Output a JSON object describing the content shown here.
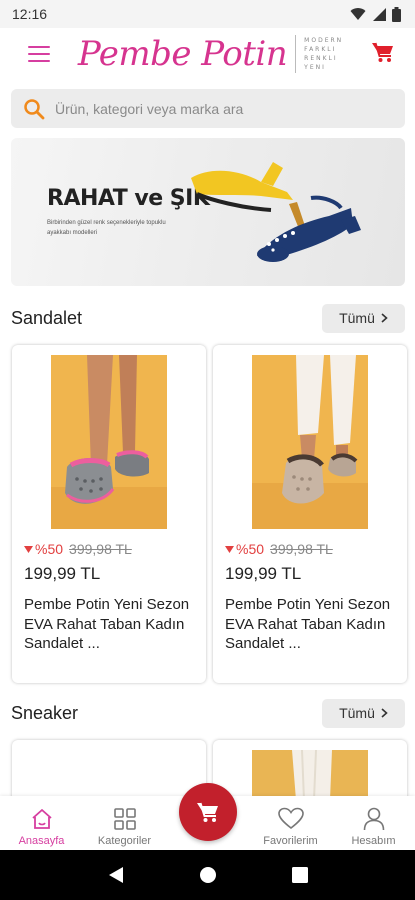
{
  "status_bar": {
    "time": "12:16"
  },
  "header": {
    "logo_text": "Pembe Potin",
    "logo_tagline": [
      "MODERN",
      "FARKLI",
      "RENKLI",
      "YENI"
    ]
  },
  "search": {
    "placeholder": "Ürün, kategori veya marka ara"
  },
  "banner": {
    "title": "RAHAT ve ŞIK",
    "subtitle": "Birbirinden güzel renk seçenekleriyle topuklu ayakkabı modelleri"
  },
  "sections": [
    {
      "title": "Sandalet",
      "all_label": "Tümü",
      "products": [
        {
          "discount": "%50",
          "old_price": "399,98 TL",
          "price": "199,99 TL",
          "name": "Pembe Potin Yeni Sezon EVA Rahat Taban Kadın Sandalet ..."
        },
        {
          "discount": "%50",
          "old_price": "399,98 TL",
          "price": "199,99 TL",
          "name": "Pembe Potin Yeni Sezon EVA Rahat Taban Kadın Sandalet ..."
        }
      ]
    },
    {
      "title": "Sneaker",
      "all_label": "Tümü"
    }
  ],
  "bottom_nav": {
    "home": "Anasayfa",
    "categories": "Kategoriler",
    "favorites": "Favorilerim",
    "account": "Hesabım"
  },
  "colors": {
    "brand_pink": "#d63ea0",
    "cart_red": "#c2202c",
    "discount_red": "#e24040"
  },
  "icons": [
    "menu-icon",
    "cart-icon",
    "search-icon",
    "home-icon",
    "grid-icon",
    "heart-icon",
    "user-icon",
    "back-icon",
    "home-circle-icon",
    "recents-icon"
  ]
}
